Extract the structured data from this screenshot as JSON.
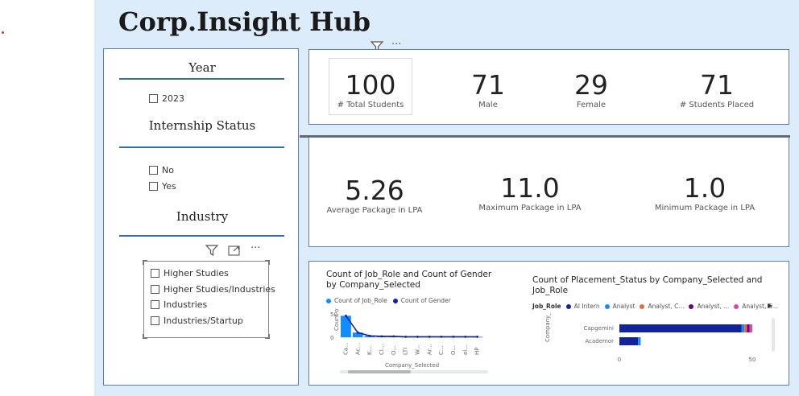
{
  "dashboard": {
    "title": "Corp.Insight Hub"
  },
  "slicers": {
    "year": {
      "header": "Year",
      "options": [
        "2023"
      ]
    },
    "internship": {
      "header": "Internship Status",
      "options": [
        "No",
        "Yes"
      ]
    },
    "industry": {
      "header": "Industry",
      "options": [
        "Higher Studies",
        "Higher Studies/Industries",
        "Industries",
        "Industries/Startup"
      ]
    }
  },
  "visual_icons": {
    "filter": "filter-icon",
    "focus": "focus-mode-icon",
    "more": "more-options-icon"
  },
  "kpis_top": [
    {
      "value": "100",
      "label": "# Total Students"
    },
    {
      "value": "71",
      "label": "Male"
    },
    {
      "value": "29",
      "label": "Female"
    },
    {
      "value": "71",
      "label": "# Students Placed"
    }
  ],
  "kpis_package": [
    {
      "value": "5.26",
      "label": "Average Package in LPA"
    },
    {
      "value": "11.0",
      "label": "Maximum Package in LPA"
    },
    {
      "value": "1.0",
      "label": "Minimum Package in LPA"
    }
  ],
  "colors": {
    "canvas": "#dcecfb",
    "accent": "#2f6db3",
    "series_blue": "#118dff",
    "series_navy": "#12239e"
  },
  "chart_data": [
    {
      "type": "bar",
      "title": "Count of Job_Role and Count of Gender by Company_Selected",
      "legend": [
        "Count of Job_Role",
        "Count of Gender"
      ],
      "xlabel": "Company_Selected",
      "ylabel": "Count of ...",
      "ylim": [
        0,
        50
      ],
      "yticks": [
        "50",
        "0"
      ],
      "categories": [
        "Ca...",
        "Ac...",
        "K...",
        "Cl...",
        "O...",
        "LTI",
        "W...",
        "Ar...",
        "C...",
        "O...",
        "el...",
        "HP"
      ],
      "series": [
        {
          "name": "Count of Job_Role",
          "kind": "bar",
          "values": [
            46,
            10,
            3,
            2,
            2,
            1,
            1,
            1,
            1,
            1,
            1,
            1
          ]
        },
        {
          "name": "Count of Gender",
          "kind": "line",
          "values": [
            46,
            10,
            3,
            2,
            2,
            1,
            1,
            1,
            1,
            1,
            1,
            1
          ]
        }
      ]
    },
    {
      "type": "bar",
      "orientation": "horizontal",
      "title": "Count of Placement_Status by Company_Selected and Job_Role",
      "legend_title": "Job_Role",
      "legend": [
        {
          "name": "AI Intern",
          "color": "#12239e"
        },
        {
          "name": "Analyst",
          "color": "#118dff"
        },
        {
          "name": "Analyst, C...",
          "color": "#e66c37"
        },
        {
          "name": "Analyst, ...",
          "color": "#6b007b"
        },
        {
          "name": "Analyst, S...",
          "color": "#e044a7"
        }
      ],
      "ylabel": "Company_S...",
      "categories": [
        "Capgemini",
        "Academor"
      ],
      "xticks": [
        "0",
        "50"
      ],
      "xlim": [
        0,
        50
      ],
      "stacks": [
        [
          46,
          1,
          1,
          1,
          1
        ],
        [
          7,
          1,
          0,
          0,
          0
        ]
      ]
    }
  ]
}
